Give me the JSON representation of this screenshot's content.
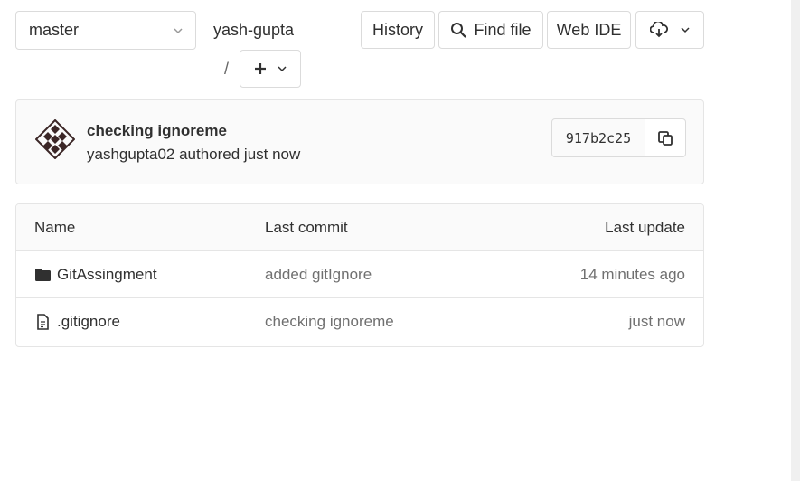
{
  "toolbar": {
    "branch": "master",
    "path_root": "yash-gupta",
    "path_separator": "/",
    "history_label": "History",
    "find_file_label": "Find file",
    "web_ide_label": "Web IDE"
  },
  "commit": {
    "title": "checking ignoreme",
    "meta": "yashgupta02 authored just now",
    "sha": "917b2c25"
  },
  "table": {
    "headers": {
      "name": "Name",
      "last_commit": "Last commit",
      "last_update": "Last update"
    },
    "rows": [
      {
        "icon": "folder-icon",
        "name": "GitAssingment",
        "last_commit": "added gitIgnore",
        "last_update": "14 minutes ago"
      },
      {
        "icon": "file-icon",
        "name": ".gitignore",
        "last_commit": "checking ignoreme",
        "last_update": "just now"
      }
    ]
  }
}
